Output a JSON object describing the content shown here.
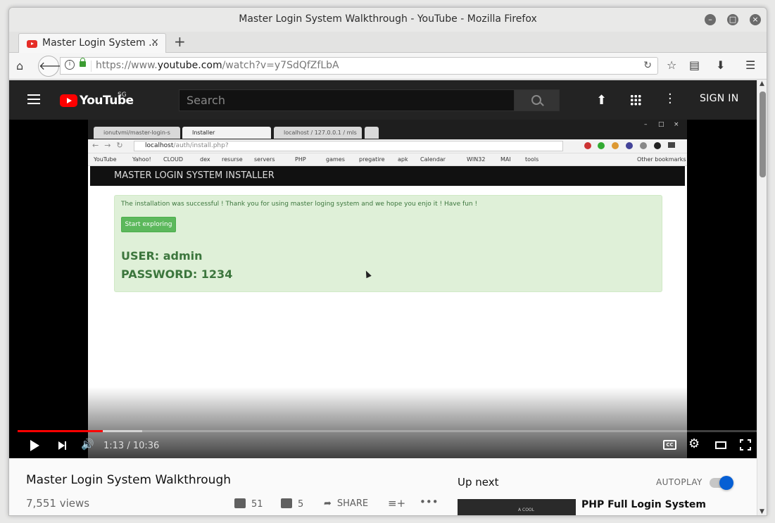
{
  "window": {
    "title": "Master Login System Walkthrough - YouTube - Mozilla Firefox"
  },
  "tab": {
    "label": "Master Login System ...",
    "close": "×",
    "new_tab": "+"
  },
  "navbar": {
    "url_prefix": "https://www.",
    "url_domain": "youtube.com",
    "url_path": "/watch?v=y7SdQfZfLbA"
  },
  "youtube": {
    "logo_text": "YouTube",
    "region": "SG",
    "search_placeholder": "Search",
    "signin": "SIGN IN"
  },
  "capture": {
    "tabs": [
      "ionutvmi/master-login-s",
      "Installer",
      "localhost / 127.0.0.1 / mls"
    ],
    "address_host": "localhost",
    "address_path": "/auth/install.php?",
    "bookmarks": [
      "YouTube",
      "Yahoo!",
      "CLOUD",
      "dex",
      "resurse",
      "servers",
      "PHP",
      "games",
      "pregatire",
      "apk",
      "Calendar",
      "WIN32",
      "MAI",
      "tools"
    ],
    "other_bookmarks": "Other bookmarks",
    "header": "MASTER LOGIN SYSTEM INSTALLER",
    "message": "The installation was successful ! Thank you for using master loging system and we hope you enjo it ! Have fun !",
    "button": "Start exploring",
    "user": "USER: admin",
    "password": "PASSWORD: 1234"
  },
  "player": {
    "time": "1:13 / 10:36",
    "progress": 0.115,
    "buffered": 0.169,
    "cc": "CC"
  },
  "video_info": {
    "title": "Master Login System Walkthrough",
    "views": "7,551 views",
    "likes": "51",
    "dislikes": "5",
    "share": "SHARE"
  },
  "sidebar": {
    "up_next": "Up next",
    "autoplay": "AUTOPLAY",
    "autoplay_on": true,
    "next_video_title": "PHP Full Login System",
    "next_thumb_text": "A COOL"
  }
}
